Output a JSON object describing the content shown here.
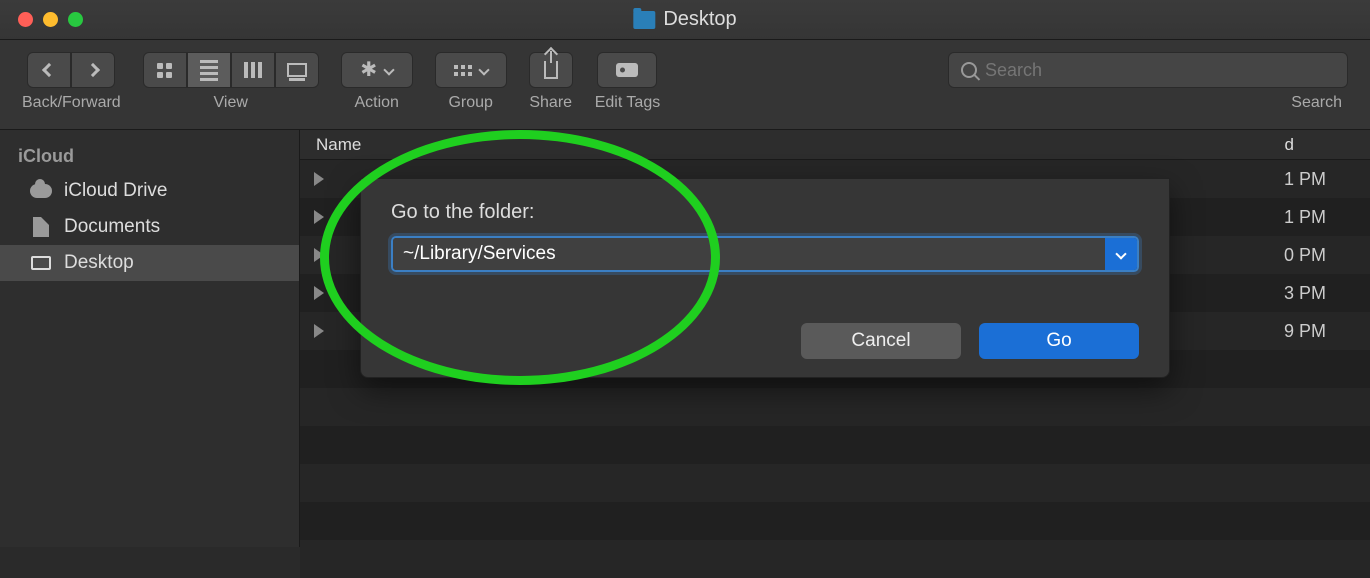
{
  "window": {
    "title": "Desktop"
  },
  "toolbar": {
    "back_forward_label": "Back/Forward",
    "view_label": "View",
    "action_label": "Action",
    "group_label": "Group",
    "share_label": "Share",
    "edit_tags_label": "Edit Tags",
    "search_label": "Search",
    "search_placeholder": "Search"
  },
  "sidebar": {
    "section": "iCloud",
    "items": [
      {
        "label": "iCloud Drive",
        "icon": "cloud",
        "selected": false
      },
      {
        "label": "Documents",
        "icon": "doc",
        "selected": false
      },
      {
        "label": "Desktop",
        "icon": "desk",
        "selected": true
      }
    ]
  },
  "columns": {
    "name": "Name",
    "modified_suffix": "d"
  },
  "rows": [
    {
      "date_tail": "1 PM"
    },
    {
      "date_tail": "1 PM"
    },
    {
      "date_tail": "0 PM"
    },
    {
      "date_tail": "3 PM"
    },
    {
      "date_tail": "9 PM"
    }
  ],
  "dialog": {
    "prompt": "Go to the folder:",
    "value": "~/Library/Services",
    "cancel": "Cancel",
    "go": "Go"
  }
}
